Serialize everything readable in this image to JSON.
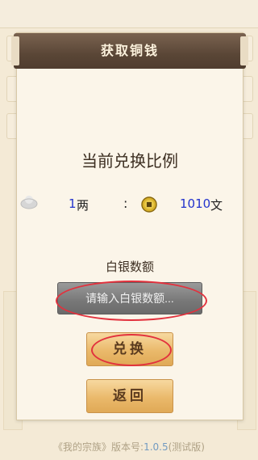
{
  "dialog": {
    "title": "获取铜钱",
    "rate_title": "当前兑换比例",
    "left_amount": "1",
    "left_unit": "两",
    "separator": ":",
    "right_amount": "1010",
    "right_unit": "文",
    "input_label": "白银数额",
    "input_placeholder": "请输入白银数额...",
    "input_value": "",
    "exchange_button": "兑换",
    "back_button": "返回"
  },
  "footer": {
    "app_name": "《我的宗族》版本号:",
    "version": "1.0.5",
    "suffix": "(测试版)"
  },
  "colors": {
    "header_bg": "#5a4636",
    "button_bg": "#eab96b",
    "highlight_ellipse": "#e2313d",
    "value_text": "#2233cc"
  }
}
